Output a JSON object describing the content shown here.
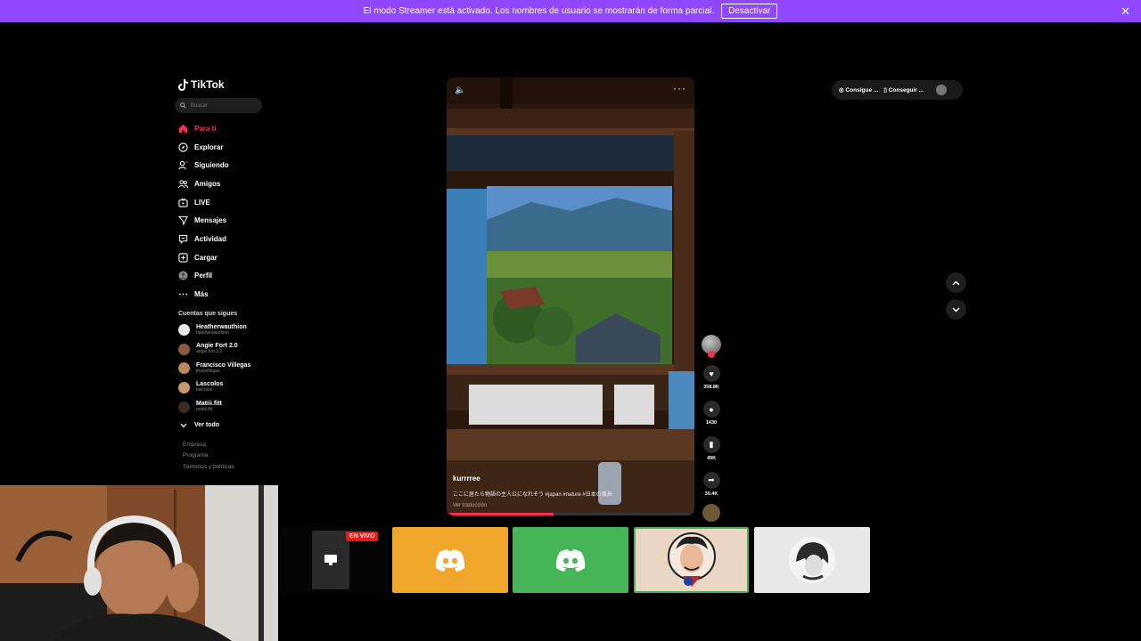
{
  "banner": {
    "message": "El modo Streamer está activado. Los nombres de usuario se mostrarán de forma parcial.",
    "button_label": "Desactivar",
    "close_glyph": "✕"
  },
  "sidebar": {
    "logo_text": "TikTok",
    "search_placeholder": "Buscar",
    "nav": [
      {
        "label": "Para ti",
        "icon": "home-icon",
        "active": true
      },
      {
        "label": "Explorar",
        "icon": "compass-icon"
      },
      {
        "label": "Siguiendo",
        "icon": "following-icon"
      },
      {
        "label": "Amigos",
        "icon": "friends-icon"
      },
      {
        "label": "LIVE",
        "icon": "live-icon"
      },
      {
        "label": "Mensajes",
        "icon": "messages-icon"
      },
      {
        "label": "Actividad",
        "icon": "activity-icon"
      },
      {
        "label": "Cargar",
        "icon": "upload-icon"
      },
      {
        "label": "Perfil",
        "icon": "profile-avatar"
      },
      {
        "label": "Más",
        "icon": "more-icon"
      }
    ],
    "following_title": "Cuentas que sigues",
    "accounts": [
      {
        "name": "Heatherwauthion",
        "handle": "heatherwauthion",
        "color": "#e9e9e9"
      },
      {
        "name": "Angie Fort 2.0",
        "handle": "angie.fort.2.0",
        "color": "#8b5a3c"
      },
      {
        "name": "Francisco Villegas",
        "handle": "jfranvillegas",
        "color": "#b98a5a"
      },
      {
        "name": "Lascolos",
        "handle": "lascolos",
        "color": "#c49a6c"
      },
      {
        "name": "Matiii.fitt",
        "handle": "matiii.fitt",
        "color": "#3a2a22"
      }
    ],
    "see_all": "Ver todo",
    "footer_links": [
      "Empresa",
      "Programa",
      "Términos y políticas"
    ]
  },
  "video": {
    "username": "kurrrree",
    "description": "ここに居たら物語の主人公になれそう #japan #nature #日本の風景",
    "translation": "Ver traducción",
    "progress": 0.43
  },
  "actions": [
    {
      "icon": "heart-icon",
      "glyph": "♥",
      "count": "358.8K"
    },
    {
      "icon": "comment-icon",
      "glyph": "●",
      "count": "1430"
    },
    {
      "icon": "bookmark-icon",
      "glyph": "▮",
      "count": "49K"
    },
    {
      "icon": "share-icon",
      "glyph": "➦",
      "count": "30.4K"
    }
  ],
  "header_pill": {
    "coins_label": "Consigue ...",
    "app_label": "Conseguir ..."
  },
  "overlay": {
    "live_badge": "EN VIVO",
    "tile_colors": [
      "#f0a62b",
      "#45b558",
      "#e9d6c4",
      "#e8e8e8"
    ]
  }
}
